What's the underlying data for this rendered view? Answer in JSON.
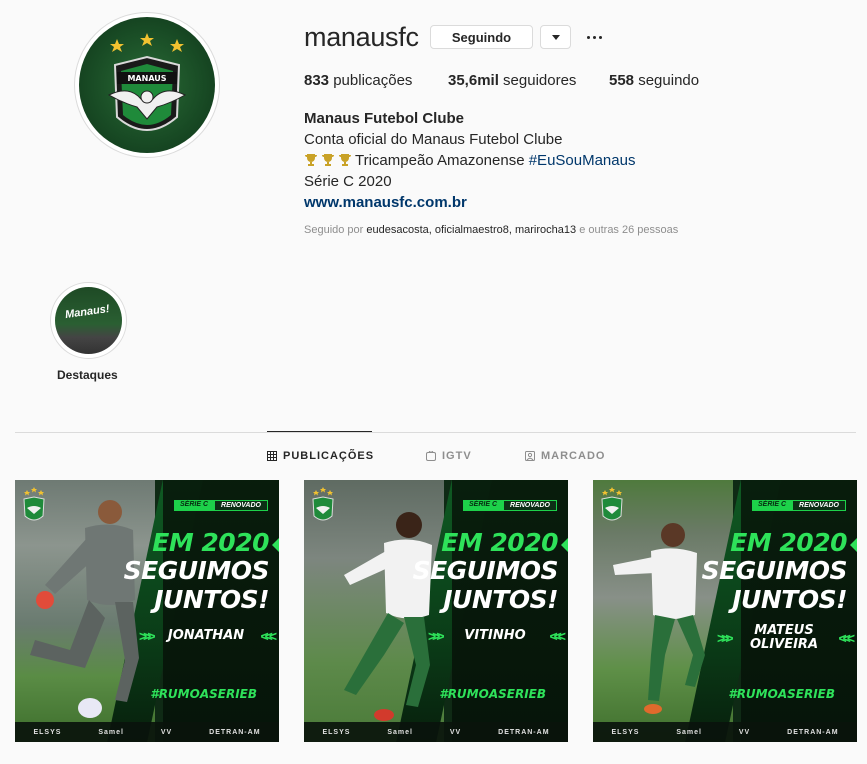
{
  "profile": {
    "username": "manausfc",
    "follow_label": "Seguindo",
    "posts_count": "833",
    "posts_label": "publicações",
    "followers_count": "35,6mil",
    "followers_label": "seguidores",
    "following_count": "558",
    "following_label": "seguindo",
    "full_name": "Manaus Futebol Clube",
    "bio_line1": "Conta oficial do Manaus Futebol Clube",
    "bio_line2_text": "Tricampeão Amazonense",
    "bio_line2_hashtag": "#EuSouManaus",
    "bio_line3": "Série C 2020",
    "website": "www.manausfc.com.br",
    "followed_by_prefix": "Seguido por",
    "followed_by_names": "eudesacosta, oficialmaestro8, marirocha13",
    "followed_by_suffix": "e outras 26 pessoas",
    "avatar_icon": "manaus-fc-crest-icon",
    "avatar_text": "MANAUS"
  },
  "highlights": [
    {
      "label": "Destaques",
      "cover_text": "Manaus!"
    }
  ],
  "tabs": [
    {
      "label": "PUBLICAÇÕES",
      "icon": "grid-icon",
      "active": true
    },
    {
      "label": "IGTV",
      "icon": "igtv-icon",
      "active": false
    },
    {
      "label": "MARCADO",
      "icon": "tagged-icon",
      "active": false
    }
  ],
  "posts": [
    {
      "tag_left": "SÉRIE C",
      "tag_right": "RENOVADO",
      "headline_1": "EM 2020",
      "headline_2": "SEGUIMOS",
      "headline_3": "JUNTOS!",
      "player_name": "JONATHAN",
      "hashtag": "#RUMOASERIEB",
      "sponsors": [
        "ELSYS",
        "Samel",
        "VV",
        "DETRAN-AM"
      ]
    },
    {
      "tag_left": "SÉRIE C",
      "tag_right": "RENOVADO",
      "headline_1": "EM 2020",
      "headline_2": "SEGUIMOS",
      "headline_3": "JUNTOS!",
      "player_name": "VITINHO",
      "hashtag": "#RUMOASERIEB",
      "sponsors": [
        "ELSYS",
        "Samel",
        "VV",
        "DETRAN-AM"
      ]
    },
    {
      "tag_left": "SÉRIE C",
      "tag_right": "RENOVADO",
      "headline_1": "EM 2020",
      "headline_2": "SEGUIMOS",
      "headline_3": "JUNTOS!",
      "player_name_1": "MATEUS",
      "player_name_2": "OLIVEIRA",
      "hashtag": "#RUMOASERIEB",
      "sponsors": [
        "ELSYS",
        "Samel",
        "VV",
        "DETRAN-AM"
      ]
    }
  ],
  "colors": {
    "brand_green": "#2ee25a",
    "link_blue": "#00376b",
    "muted_gray": "#8e8e8e"
  }
}
